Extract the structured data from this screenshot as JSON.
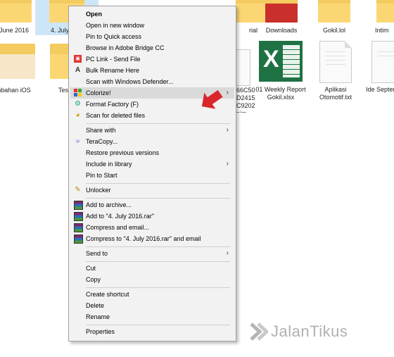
{
  "desktop": {
    "files": [
      {
        "name": "June 2016",
        "type": "folder"
      },
      {
        "name": "4. July",
        "type": "folder"
      },
      {
        "name": "rial",
        "type": "folder"
      },
      {
        "name": "Downloads",
        "type": "folder"
      },
      {
        "name": "Gokil.lol",
        "type": "folder"
      },
      {
        "name": "Intim",
        "type": "folder"
      },
      {
        "name": "nbahan iOS",
        "type": "folder"
      },
      {
        "name": "Tes",
        "type": "folder"
      },
      {
        "name": "66C50\nD2415\nC9202\npim...",
        "type": "file"
      },
      {
        "name": "01 Weekly Report\nGokil.xlsx",
        "type": "excel"
      },
      {
        "name": "Aplikasi\nOtomotif.txt",
        "type": "text"
      },
      {
        "name": "Ide Septem",
        "type": "text"
      }
    ]
  },
  "context_menu": {
    "items": [
      {
        "label": "Open",
        "icon": "none",
        "bold": true
      },
      {
        "label": "Open in new window",
        "icon": "none"
      },
      {
        "label": "Pin to Quick access",
        "icon": "none"
      },
      {
        "label": "Browse in Adobe Bridge CC",
        "icon": "none"
      },
      {
        "label": "PC Link - Send File",
        "icon": "pc-link-icon"
      },
      {
        "label": "Bulk Rename Here",
        "icon": "bulk-rename-icon"
      },
      {
        "label": "Scan with Windows Defender...",
        "icon": "none"
      },
      {
        "label": "Colorize!",
        "icon": "colorize-icon",
        "submenu": true,
        "highlighted": true
      },
      {
        "label": "Format Factory (F)",
        "icon": "format-factory-icon"
      },
      {
        "label": "Scan for deleted files",
        "icon": "recover-icon"
      },
      {
        "label": "Share with",
        "icon": "none",
        "submenu": true
      },
      {
        "label": "TeraCopy...",
        "icon": "teracopy-icon"
      },
      {
        "label": "Restore previous versions",
        "icon": "none"
      },
      {
        "label": "Include in library",
        "icon": "none",
        "submenu": true
      },
      {
        "label": "Pin to Start",
        "icon": "none"
      },
      {
        "label": "Unlocker",
        "icon": "unlocker-icon"
      },
      {
        "label": "Add to archive...",
        "icon": "winrar-icon"
      },
      {
        "label": "Add to \"4. July 2016.rar\"",
        "icon": "winrar-icon"
      },
      {
        "label": "Compress and email...",
        "icon": "winrar-icon"
      },
      {
        "label": "Compress to \"4. July 2016.rar\" and email",
        "icon": "winrar-icon"
      },
      {
        "label": "Send to",
        "icon": "none",
        "submenu": true
      },
      {
        "label": "Cut",
        "icon": "none"
      },
      {
        "label": "Copy",
        "icon": "none"
      },
      {
        "label": "Create shortcut",
        "icon": "none"
      },
      {
        "label": "Delete",
        "icon": "none"
      },
      {
        "label": "Rename",
        "icon": "none"
      },
      {
        "label": "Properties",
        "icon": "none"
      }
    ]
  },
  "watermark": {
    "text": "JalanTikus"
  },
  "colors": {
    "menu_bg": "#f2f2f2",
    "highlight": "#dadada",
    "arrow": "#d9262c",
    "folder": "#f3cb5e",
    "excel": "#1f7244"
  }
}
